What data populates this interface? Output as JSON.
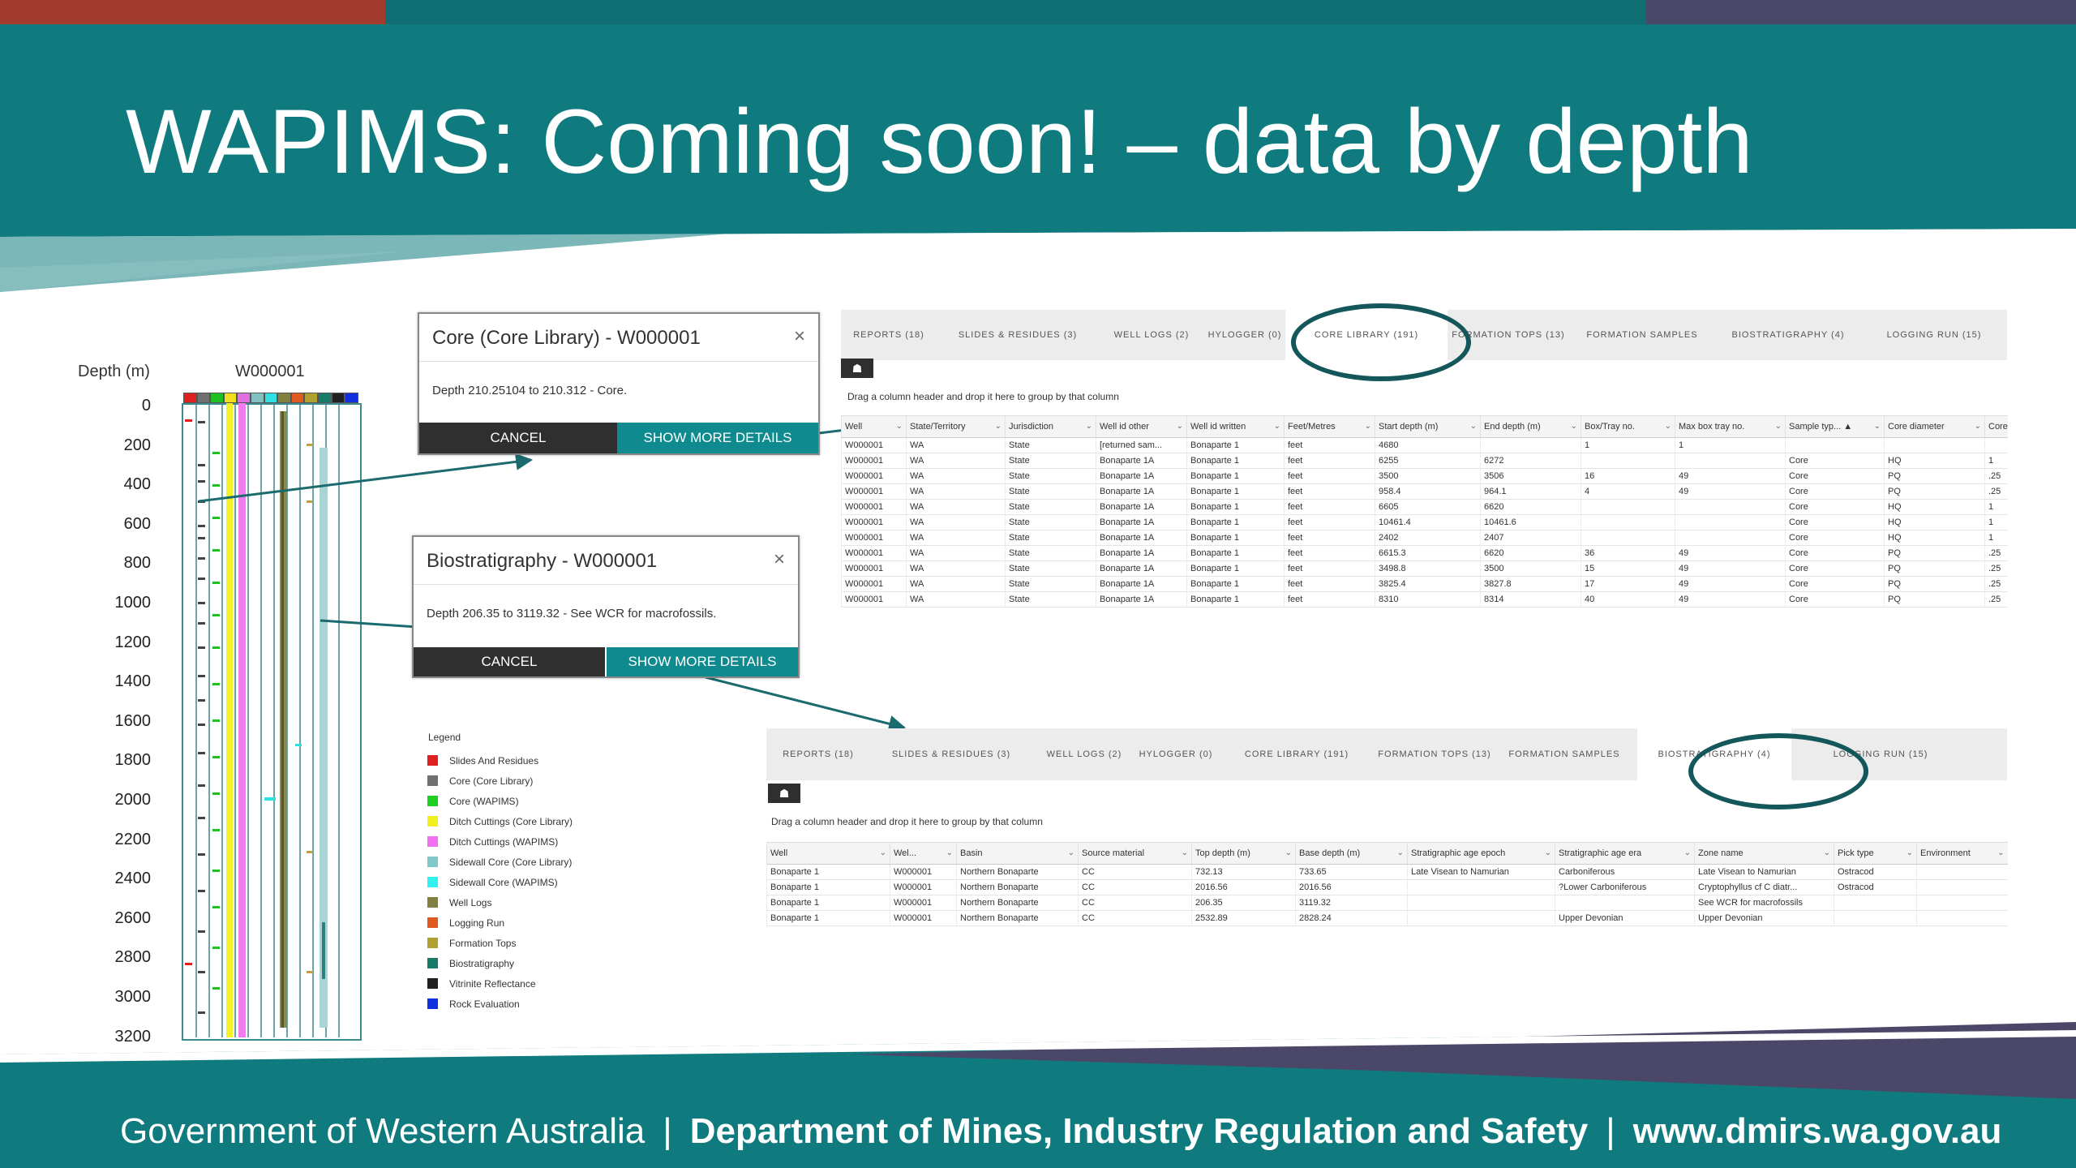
{
  "slide": {
    "title": "WAPIMS: Coming soon! – data by depth",
    "footer": {
      "gov": "Government of Western Australia",
      "dept": "Department of Mines, Industry Regulation and Safety",
      "url": "www.dmirs.wa.gov.au",
      "sep": "|"
    }
  },
  "depth_log": {
    "depth_label": "Depth (m)",
    "well_label": "W000001",
    "ticks": [
      "0",
      "200",
      "400",
      "600",
      "800",
      "1000",
      "1200",
      "1400",
      "1600",
      "1800",
      "2000",
      "2200",
      "2400",
      "2600",
      "2800",
      "3000",
      "3200"
    ],
    "header_colors": [
      "#e02020",
      "#707070",
      "#20c020",
      "#f0e020",
      "#e070e0",
      "#80c0c0",
      "#30e0e0",
      "#808040",
      "#e05a20",
      "#b0a030",
      "#1a7a6a",
      "#202020",
      "#1030e0"
    ]
  },
  "legend": {
    "title": "Legend",
    "items": [
      {
        "label": "Slides And Residues",
        "color": "#e02020"
      },
      {
        "label": "Core (Core Library)",
        "color": "#707070"
      },
      {
        "label": "Core (WAPIMS)",
        "color": "#20d020"
      },
      {
        "label": "Ditch Cuttings (Core Library)",
        "color": "#f0f020"
      },
      {
        "label": "Ditch Cuttings (WAPIMS)",
        "color": "#f070f0"
      },
      {
        "label": "Sidewall Core (Core Library)",
        "color": "#80c8c8"
      },
      {
        "label": "Sidewall Core (WAPIMS)",
        "color": "#30f0f0"
      },
      {
        "label": "Well Logs",
        "color": "#808040"
      },
      {
        "label": "Logging Run",
        "color": "#e05a20"
      },
      {
        "label": "Formation Tops",
        "color": "#b0a030"
      },
      {
        "label": "Biostratigraphy",
        "color": "#1a7a6a"
      },
      {
        "label": "Vitrinite Reflectance",
        "color": "#202020"
      },
      {
        "label": "Rock Evaluation",
        "color": "#1030e0"
      }
    ]
  },
  "dialog_core": {
    "title": "Core (Core Library) - W000001",
    "close": "×",
    "body": "Depth 210.25104 to 210.312 - Core.",
    "cancel": "CANCEL",
    "more": "SHOW MORE DETAILS"
  },
  "dialog_bio": {
    "title": "Biostratigraphy - W000001",
    "close": "×",
    "body": "Depth 206.35 to 3119.32 - See WCR for macrofossils.",
    "cancel": "CANCEL",
    "more": "SHOW MORE DETAILS"
  },
  "grid_top": {
    "tabs": [
      "REPORTS (18)",
      "SLIDES & RESIDUES (3)",
      "WELL LOGS (2)",
      "HYLOGGER (0)",
      "CORE LIBRARY (191)",
      "FORMATION TOPS (13)",
      "FORMATION SAMPLES",
      "BIOSTRATIGRAPHY (4)",
      "LOGGING RUN (15)"
    ],
    "active_tab": "CORE LIBRARY (191)",
    "toolbar_icon": "☗",
    "group_hint": "Drag a column header and drop it here to group by that column",
    "columns": [
      "Well",
      "State/Territory",
      "Jurisdiction",
      "Well id other",
      "Well id written",
      "Feet/Metres",
      "Start depth (m)",
      "End depth (m)",
      "Box/Tray no.",
      "Max box tray no.",
      "Sample typ... ▲",
      "Core diameter",
      "Core"
    ],
    "rows": [
      [
        "W000001",
        "WA",
        "State",
        "[returned sam...",
        "Bonaparte 1",
        "feet",
        "4680",
        "",
        "1",
        "1",
        "",
        "",
        ""
      ],
      [
        "W000001",
        "WA",
        "State",
        "Bonaparte 1A",
        "Bonaparte 1",
        "feet",
        "6255",
        "6272",
        "",
        "",
        "Core",
        "HQ",
        "1"
      ],
      [
        "W000001",
        "WA",
        "State",
        "Bonaparte 1A",
        "Bonaparte 1",
        "feet",
        "3500",
        "3506",
        "16",
        "49",
        "Core",
        "PQ",
        ".25"
      ],
      [
        "W000001",
        "WA",
        "State",
        "Bonaparte 1A",
        "Bonaparte 1",
        "feet",
        "958.4",
        "964.1",
        "4",
        "49",
        "Core",
        "PQ",
        ".25"
      ],
      [
        "W000001",
        "WA",
        "State",
        "Bonaparte 1A",
        "Bonaparte 1",
        "feet",
        "6605",
        "6620",
        "",
        "",
        "Core",
        "HQ",
        "1"
      ],
      [
        "W000001",
        "WA",
        "State",
        "Bonaparte 1A",
        "Bonaparte 1",
        "feet",
        "10461.4",
        "10461.6",
        "",
        "",
        "Core",
        "HQ",
        "1"
      ],
      [
        "W000001",
        "WA",
        "State",
        "Bonaparte 1A",
        "Bonaparte 1",
        "feet",
        "2402",
        "2407",
        "",
        "",
        "Core",
        "HQ",
        "1"
      ],
      [
        "W000001",
        "WA",
        "State",
        "Bonaparte 1A",
        "Bonaparte 1",
        "feet",
        "6615.3",
        "6620",
        "36",
        "49",
        "Core",
        "PQ",
        ".25"
      ],
      [
        "W000001",
        "WA",
        "State",
        "Bonaparte 1A",
        "Bonaparte 1",
        "feet",
        "3498.8",
        "3500",
        "15",
        "49",
        "Core",
        "PQ",
        ".25"
      ],
      [
        "W000001",
        "WA",
        "State",
        "Bonaparte 1A",
        "Bonaparte 1",
        "feet",
        "3825.4",
        "3827.8",
        "17",
        "49",
        "Core",
        "PQ",
        ".25"
      ],
      [
        "W000001",
        "WA",
        "State",
        "Bonaparte 1A",
        "Bonaparte 1",
        "feet",
        "8310",
        "8314",
        "40",
        "49",
        "Core",
        "PQ",
        ".25"
      ]
    ]
  },
  "grid_bottom": {
    "tabs": [
      "REPORTS (18)",
      "SLIDES & RESIDUES (3)",
      "WELL LOGS (2)",
      "HYLOGGER (0)",
      "CORE LIBRARY (191)",
      "FORMATION TOPS (13)",
      "FORMATION SAMPLES",
      "BIOSTRATIGRAPHY (4)",
      "LOGGING RUN (15)"
    ],
    "active_tab": "BIOSTRATIGRAPHY (4)",
    "toolbar_icon": "☗",
    "group_hint": "Drag a column header and drop it here to group by that column",
    "columns": [
      "Well",
      "Wel...",
      "Basin",
      "Source material",
      "Top depth (m)",
      "Base depth (m)",
      "Stratigraphic age epoch",
      "Stratigraphic age era",
      "Zone name",
      "Pick type",
      "Environment"
    ],
    "rows": [
      [
        "Bonaparte 1",
        "W000001",
        "Northern Bonaparte",
        "CC",
        "732.13",
        "733.65",
        "Late Visean to Namurian",
        "Carboniferous",
        "Late Visean to Namurian",
        "Ostracod",
        ""
      ],
      [
        "Bonaparte 1",
        "W000001",
        "Northern Bonaparte",
        "CC",
        "2016.56",
        "2016.56",
        "",
        "?Lower Carboniferous",
        "Cryptophyllus cf C diatr...",
        "Ostracod",
        ""
      ],
      [
        "Bonaparte 1",
        "W000001",
        "Northern Bonaparte",
        "CC",
        "206.35",
        "3119.32",
        "",
        "",
        "See WCR for macrofossils",
        "",
        ""
      ],
      [
        "Bonaparte 1",
        "W000001",
        "Northern Bonaparte",
        "CC",
        "2532.89",
        "2828.24",
        "",
        "Upper Devonian",
        "Upper Devonian",
        "",
        ""
      ]
    ]
  }
}
